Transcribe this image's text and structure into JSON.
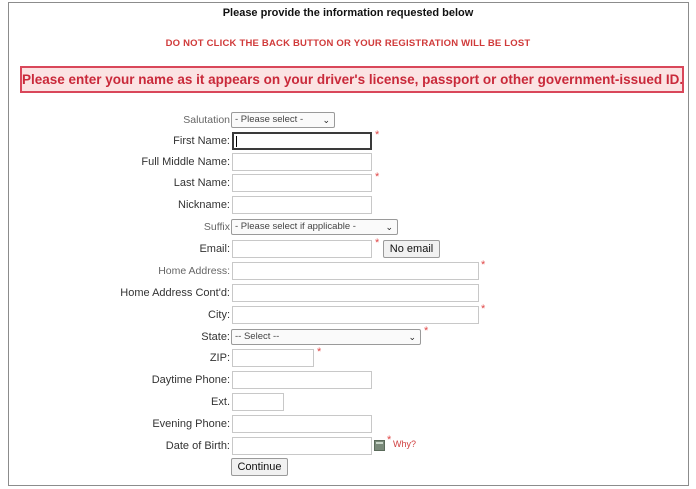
{
  "header": {
    "title": "Please provide the information requested below",
    "warning": "DO NOT CLICK THE BACK BUTTON OR YOUR REGISTRATION WILL BE LOST",
    "notice": "Please enter your name as it appears on your driver's license, passport or other government-issued ID."
  },
  "form": {
    "salutation": {
      "label": "Salutation",
      "selected": "- Please select -"
    },
    "first_name": {
      "label": "First Name:",
      "value": ""
    },
    "middle_name": {
      "label": "Full Middle Name:",
      "value": ""
    },
    "last_name": {
      "label": "Last Name:",
      "value": ""
    },
    "nickname": {
      "label": "Nickname:",
      "value": ""
    },
    "suffix": {
      "label": "Suffix",
      "selected": "- Please select if applicable -"
    },
    "email": {
      "label": "Email:",
      "value": "",
      "no_email_label": "No email"
    },
    "home_address": {
      "label": "Home Address:",
      "value": ""
    },
    "home_address2": {
      "label": "Home Address Cont'd:",
      "value": ""
    },
    "city": {
      "label": "City:",
      "value": ""
    },
    "state": {
      "label": "State:",
      "selected": "-- Select --"
    },
    "zip": {
      "label": "ZIP:",
      "value": ""
    },
    "daytime_phone": {
      "label": "Daytime Phone:",
      "value": ""
    },
    "ext": {
      "label": "Ext.",
      "value": ""
    },
    "evening_phone": {
      "label": "Evening Phone:",
      "value": ""
    },
    "dob": {
      "label": "Date of Birth:",
      "value": "",
      "why_label": "Why?"
    },
    "required_mark": "*",
    "continue_label": "Continue"
  },
  "icons": {
    "dropdown": "chevron-down-icon",
    "calendar": "calendar-icon"
  },
  "colors": {
    "warning": "#d03a3a",
    "notice_bg": "#fbe3e3",
    "notice_border": "#d9475a"
  }
}
